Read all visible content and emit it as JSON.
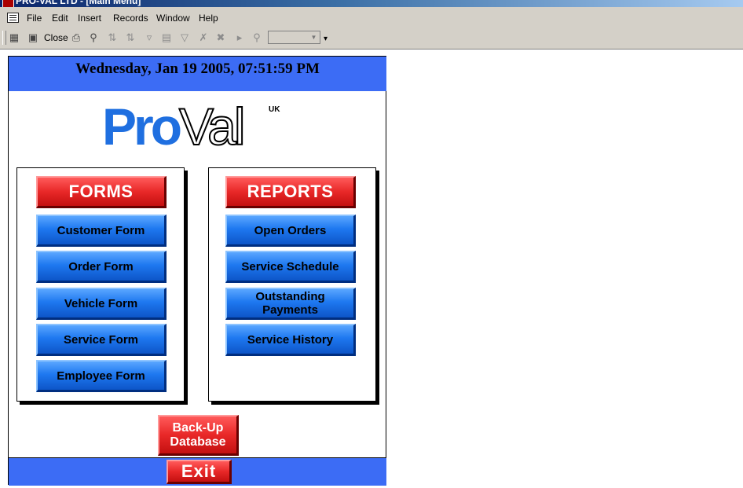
{
  "window": {
    "title": "PRO-VAL LTD - [Main Menu]"
  },
  "menu": {
    "items": [
      "File",
      "Edit",
      "Insert",
      "Records",
      "Window",
      "Help"
    ]
  },
  "toolbar": {
    "close_label": "Close",
    "icons": [
      "view-icon",
      "save-icon",
      "print-icon",
      "print-preview-icon",
      "sort-ascending-icon",
      "sort-descending-icon",
      "filter-by-selection-icon",
      "filter-by-form-icon",
      "apply-filter-icon",
      "remove-filter-icon",
      "delete-record-icon",
      "new-record-icon",
      "find-icon"
    ],
    "combo_value": ""
  },
  "form": {
    "datetime": "Wednesday, Jan 19 2005, 07:51:59 PM",
    "logo": {
      "pro": "Pro",
      "val": "Val",
      "uk": "UK"
    },
    "forms_panel": {
      "header": "FORMS",
      "buttons": [
        "Customer Form",
        "Order Form",
        "Vehicle Form",
        "Service Form",
        "Employee Form"
      ]
    },
    "reports_panel": {
      "header": "REPORTS",
      "buttons": [
        "Open Orders",
        "Service Schedule",
        "Outstanding Payments",
        "Service History"
      ]
    },
    "backup_label": "Back-Up\nDatabase",
    "exit_label": "Exit"
  },
  "colors": {
    "accent_blue": "#3c6cf5",
    "button_blue": "#1e78f0",
    "button_red": "#e82828",
    "logo_blue": "#1f6fe0",
    "chrome": "#d4d0c8"
  }
}
